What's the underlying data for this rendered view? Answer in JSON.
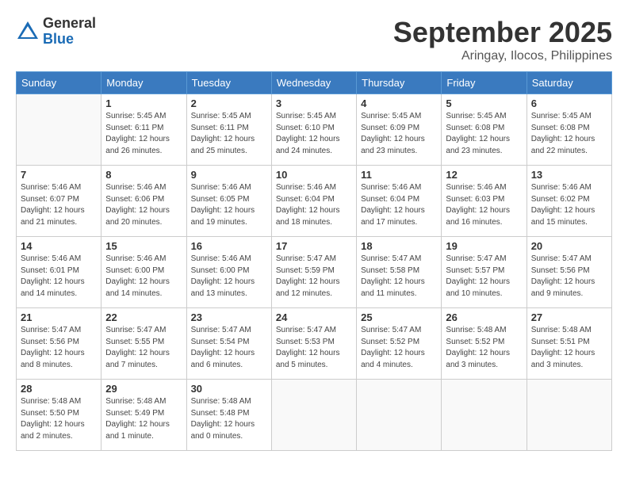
{
  "logo": {
    "general": "General",
    "blue": "Blue"
  },
  "title": "September 2025",
  "subtitle": "Aringay, Ilocos, Philippines",
  "days": [
    "Sunday",
    "Monday",
    "Tuesday",
    "Wednesday",
    "Thursday",
    "Friday",
    "Saturday"
  ],
  "weeks": [
    [
      {
        "day": "",
        "info": ""
      },
      {
        "day": "1",
        "info": "Sunrise: 5:45 AM\nSunset: 6:11 PM\nDaylight: 12 hours\nand 26 minutes."
      },
      {
        "day": "2",
        "info": "Sunrise: 5:45 AM\nSunset: 6:11 PM\nDaylight: 12 hours\nand 25 minutes."
      },
      {
        "day": "3",
        "info": "Sunrise: 5:45 AM\nSunset: 6:10 PM\nDaylight: 12 hours\nand 24 minutes."
      },
      {
        "day": "4",
        "info": "Sunrise: 5:45 AM\nSunset: 6:09 PM\nDaylight: 12 hours\nand 23 minutes."
      },
      {
        "day": "5",
        "info": "Sunrise: 5:45 AM\nSunset: 6:08 PM\nDaylight: 12 hours\nand 23 minutes."
      },
      {
        "day": "6",
        "info": "Sunrise: 5:45 AM\nSunset: 6:08 PM\nDaylight: 12 hours\nand 22 minutes."
      }
    ],
    [
      {
        "day": "7",
        "info": "Sunrise: 5:46 AM\nSunset: 6:07 PM\nDaylight: 12 hours\nand 21 minutes."
      },
      {
        "day": "8",
        "info": "Sunrise: 5:46 AM\nSunset: 6:06 PM\nDaylight: 12 hours\nand 20 minutes."
      },
      {
        "day": "9",
        "info": "Sunrise: 5:46 AM\nSunset: 6:05 PM\nDaylight: 12 hours\nand 19 minutes."
      },
      {
        "day": "10",
        "info": "Sunrise: 5:46 AM\nSunset: 6:04 PM\nDaylight: 12 hours\nand 18 minutes."
      },
      {
        "day": "11",
        "info": "Sunrise: 5:46 AM\nSunset: 6:04 PM\nDaylight: 12 hours\nand 17 minutes."
      },
      {
        "day": "12",
        "info": "Sunrise: 5:46 AM\nSunset: 6:03 PM\nDaylight: 12 hours\nand 16 minutes."
      },
      {
        "day": "13",
        "info": "Sunrise: 5:46 AM\nSunset: 6:02 PM\nDaylight: 12 hours\nand 15 minutes."
      }
    ],
    [
      {
        "day": "14",
        "info": "Sunrise: 5:46 AM\nSunset: 6:01 PM\nDaylight: 12 hours\nand 14 minutes."
      },
      {
        "day": "15",
        "info": "Sunrise: 5:46 AM\nSunset: 6:00 PM\nDaylight: 12 hours\nand 14 minutes."
      },
      {
        "day": "16",
        "info": "Sunrise: 5:46 AM\nSunset: 6:00 PM\nDaylight: 12 hours\nand 13 minutes."
      },
      {
        "day": "17",
        "info": "Sunrise: 5:47 AM\nSunset: 5:59 PM\nDaylight: 12 hours\nand 12 minutes."
      },
      {
        "day": "18",
        "info": "Sunrise: 5:47 AM\nSunset: 5:58 PM\nDaylight: 12 hours\nand 11 minutes."
      },
      {
        "day": "19",
        "info": "Sunrise: 5:47 AM\nSunset: 5:57 PM\nDaylight: 12 hours\nand 10 minutes."
      },
      {
        "day": "20",
        "info": "Sunrise: 5:47 AM\nSunset: 5:56 PM\nDaylight: 12 hours\nand 9 minutes."
      }
    ],
    [
      {
        "day": "21",
        "info": "Sunrise: 5:47 AM\nSunset: 5:56 PM\nDaylight: 12 hours\nand 8 minutes."
      },
      {
        "day": "22",
        "info": "Sunrise: 5:47 AM\nSunset: 5:55 PM\nDaylight: 12 hours\nand 7 minutes."
      },
      {
        "day": "23",
        "info": "Sunrise: 5:47 AM\nSunset: 5:54 PM\nDaylight: 12 hours\nand 6 minutes."
      },
      {
        "day": "24",
        "info": "Sunrise: 5:47 AM\nSunset: 5:53 PM\nDaylight: 12 hours\nand 5 minutes."
      },
      {
        "day": "25",
        "info": "Sunrise: 5:47 AM\nSunset: 5:52 PM\nDaylight: 12 hours\nand 4 minutes."
      },
      {
        "day": "26",
        "info": "Sunrise: 5:48 AM\nSunset: 5:52 PM\nDaylight: 12 hours\nand 3 minutes."
      },
      {
        "day": "27",
        "info": "Sunrise: 5:48 AM\nSunset: 5:51 PM\nDaylight: 12 hours\nand 3 minutes."
      }
    ],
    [
      {
        "day": "28",
        "info": "Sunrise: 5:48 AM\nSunset: 5:50 PM\nDaylight: 12 hours\nand 2 minutes."
      },
      {
        "day": "29",
        "info": "Sunrise: 5:48 AM\nSunset: 5:49 PM\nDaylight: 12 hours\nand 1 minute."
      },
      {
        "day": "30",
        "info": "Sunrise: 5:48 AM\nSunset: 5:48 PM\nDaylight: 12 hours\nand 0 minutes."
      },
      {
        "day": "",
        "info": ""
      },
      {
        "day": "",
        "info": ""
      },
      {
        "day": "",
        "info": ""
      },
      {
        "day": "",
        "info": ""
      }
    ]
  ]
}
